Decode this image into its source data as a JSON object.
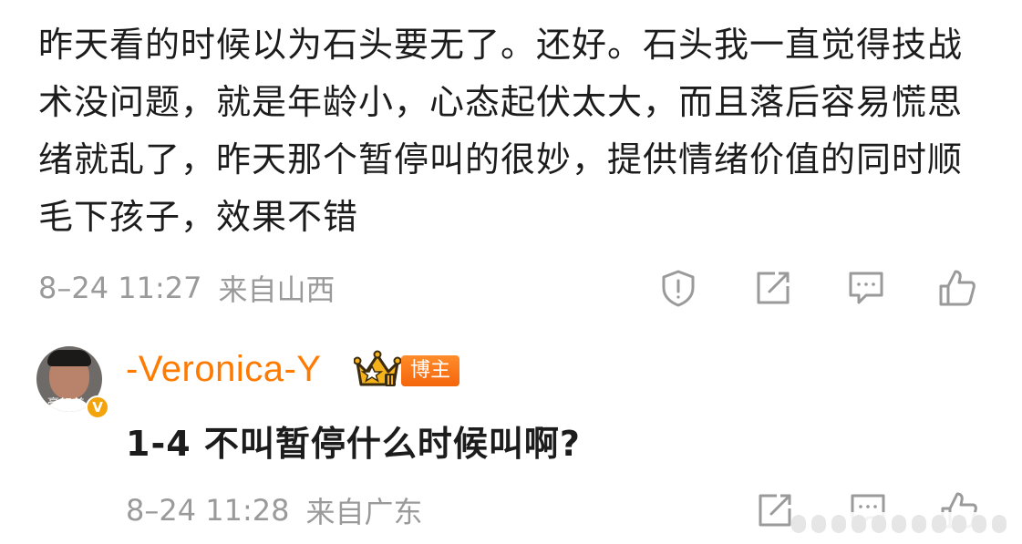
{
  "comment": {
    "text": "昨天看的时候以为石头要无了。还好。石头我一直觉得技战术没问题，就是年龄小，心态起伏太大，而且落后容易慌思绪就乱了，昨天那个暂停叫的很妙，提供情绪价值的同时顺毛下孩子，效果不错",
    "timestamp": "8–24 11:27",
    "location": "来自山西",
    "actions": {
      "report_icon": "report-icon",
      "repost_icon": "repost-icon",
      "comment_icon": "comment-icon",
      "like_icon": "like-icon"
    }
  },
  "reply": {
    "username": "-Veronica-Y",
    "badge_label": "博主",
    "avatar_caption": "豪好美",
    "verified_mark": "V",
    "text": "1-4 不叫暂停什么时候叫啊?",
    "timestamp": "8–24 11:28",
    "location": "来自广东",
    "actions": {
      "repost_icon": "repost-icon",
      "comment_icon": "comment-icon",
      "like_icon": "like-icon"
    }
  },
  "colors": {
    "username": "#ff7a00",
    "meta_text": "#9a9a9a",
    "badge_bg": "#f4650c",
    "icon_stroke": "#9a9a9a"
  }
}
